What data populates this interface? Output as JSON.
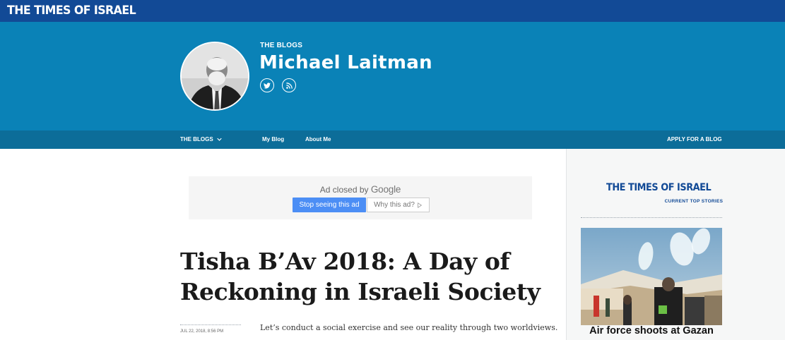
{
  "site": {
    "logo": "THE TIMES OF ISRAEL"
  },
  "header": {
    "section_label": "THE BLOGS",
    "author_name": "Michael Laitman",
    "social_icons": [
      "twitter-icon",
      "rss-icon"
    ]
  },
  "nav": {
    "blogs": "THE BLOGS",
    "my_blog": "My Blog",
    "about_me": "About Me",
    "apply": "APPLY FOR A BLOG"
  },
  "ad": {
    "closed_text": "Ad closed by",
    "brand": "Google",
    "stop_label": "Stop seeing this ad",
    "why_label": "Why this ad?"
  },
  "article": {
    "title": "Tisha B’Av 2018: A Day of Reckoning in Israeli Society",
    "date": "JUL 22, 2018, 8:56 PM",
    "lead": "Let’s conduct a social exercise and see our reality through two worldviews."
  },
  "sidebar": {
    "logo": "THE TIMES OF ISRAEL",
    "subtitle": "CURRENT TOP STORIES",
    "story_title": "Air force shoots at Gazan"
  },
  "colors": {
    "topbar": "#124a96",
    "header": "#0a82b7",
    "navbar": "#0c6d99",
    "ad_button": "#4c8ef5"
  }
}
